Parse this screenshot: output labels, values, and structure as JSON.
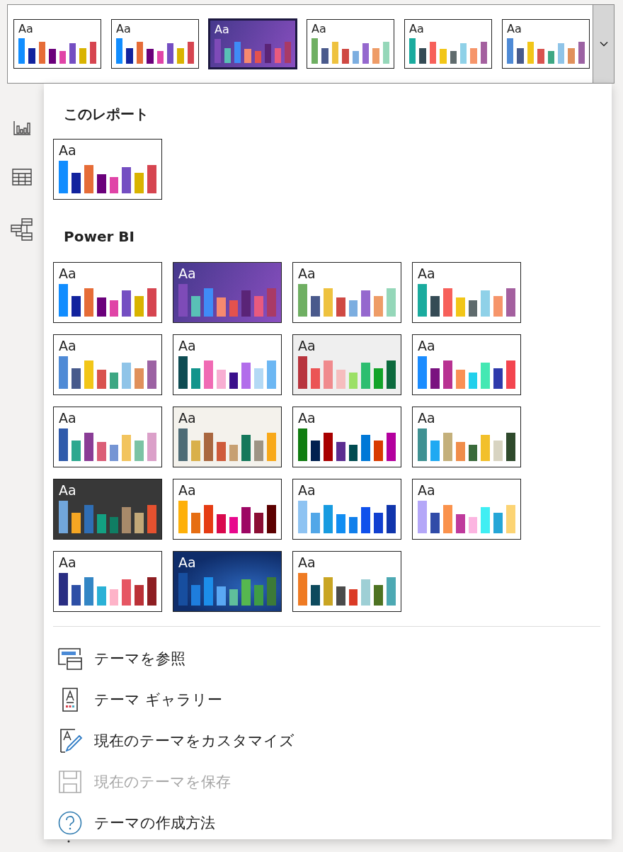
{
  "ribbon": {
    "themes": [
      {
        "label": "Aa",
        "kind": "light",
        "selected": false,
        "bars": [
          {
            "color": "#118dff"
          },
          {
            "color": "#12239e"
          },
          {
            "color": "#e66c37"
          },
          {
            "color": "#6b007b"
          },
          {
            "color": "#e044a7"
          },
          {
            "color": "#744ec2"
          },
          {
            "color": "#d9b300"
          },
          {
            "color": "#d64550"
          }
        ]
      },
      {
        "label": "Aa",
        "kind": "light",
        "selected": false,
        "bars": [
          {
            "color": "#118dff"
          },
          {
            "color": "#12239e"
          },
          {
            "color": "#e66c37"
          },
          {
            "color": "#6b007b"
          },
          {
            "color": "#e044a7"
          },
          {
            "color": "#744ec2"
          },
          {
            "color": "#d9b300"
          },
          {
            "color": "#d64550"
          }
        ]
      },
      {
        "label": "Aa",
        "kind": "purple",
        "selected": true,
        "bars": [
          {
            "color": "#7e4bb8"
          },
          {
            "color": "#59c1b6"
          },
          {
            "color": "#3f8cf7"
          },
          {
            "color": "#f6896f"
          },
          {
            "color": "#e3524e"
          },
          {
            "color": "#5a2477"
          },
          {
            "color": "#e85a7f"
          },
          {
            "color": "#a93a66"
          }
        ]
      },
      {
        "label": "Aa",
        "kind": "light",
        "selected": false,
        "bars": [
          {
            "color": "#6faf62"
          },
          {
            "color": "#4a5a8c"
          },
          {
            "color": "#eec23f"
          },
          {
            "color": "#cf4943"
          },
          {
            "color": "#7caee0"
          },
          {
            "color": "#9568ce"
          },
          {
            "color": "#ee9c67"
          },
          {
            "color": "#95d7b9"
          }
        ]
      },
      {
        "label": "Aa",
        "kind": "light",
        "selected": false,
        "bars": [
          {
            "color": "#1aab9e"
          },
          {
            "color": "#354b55"
          },
          {
            "color": "#f7605a"
          },
          {
            "color": "#f2c618"
          },
          {
            "color": "#5f6b6d"
          },
          {
            "color": "#8fd1e8"
          },
          {
            "color": "#f6956a"
          },
          {
            "color": "#a4609f"
          }
        ]
      },
      {
        "label": "Aa",
        "kind": "light",
        "selected": false,
        "bars": [
          {
            "color": "#4e8ad6"
          },
          {
            "color": "#475a8c"
          },
          {
            "color": "#f2c618"
          },
          {
            "color": "#d9534f"
          },
          {
            "color": "#3da783"
          },
          {
            "color": "#8fc4e8"
          },
          {
            "color": "#e0905b"
          },
          {
            "color": "#9c62a3"
          }
        ]
      }
    ]
  },
  "menu": {
    "sections": [
      {
        "heading": "このレポート",
        "themes": [
          {
            "label": "Aa",
            "kind": "light",
            "selected": false,
            "bars": [
              {
                "color": "#118dff"
              },
              {
                "color": "#12239e"
              },
              {
                "color": "#e66c37"
              },
              {
                "color": "#6b007b"
              },
              {
                "color": "#e044a7"
              },
              {
                "color": "#744ec2"
              },
              {
                "color": "#d9b300"
              },
              {
                "color": "#d64550"
              }
            ]
          }
        ]
      },
      {
        "heading": "Power BI",
        "themes": [
          {
            "label": "Aa",
            "kind": "light",
            "selected": false,
            "bars": [
              {
                "color": "#118dff"
              },
              {
                "color": "#12239e"
              },
              {
                "color": "#e66c37"
              },
              {
                "color": "#6b007b"
              },
              {
                "color": "#e044a7"
              },
              {
                "color": "#744ec2"
              },
              {
                "color": "#d9b300"
              },
              {
                "color": "#d64550"
              }
            ]
          },
          {
            "label": "Aa",
            "kind": "purple",
            "selected": false,
            "bars": [
              {
                "color": "#7e4bb8"
              },
              {
                "color": "#59c1b6"
              },
              {
                "color": "#3f8cf7"
              },
              {
                "color": "#f6896f"
              },
              {
                "color": "#e3524e"
              },
              {
                "color": "#5a2477"
              },
              {
                "color": "#e85a7f"
              },
              {
                "color": "#a93a66"
              }
            ]
          },
          {
            "label": "Aa",
            "kind": "light",
            "selected": false,
            "bars": [
              {
                "color": "#6faf62"
              },
              {
                "color": "#4a5a8c"
              },
              {
                "color": "#eec23f"
              },
              {
                "color": "#cf4943"
              },
              {
                "color": "#7caee0"
              },
              {
                "color": "#9568ce"
              },
              {
                "color": "#ee9c67"
              },
              {
                "color": "#95d7b9"
              }
            ]
          },
          {
            "label": "Aa",
            "kind": "light",
            "selected": false,
            "bars": [
              {
                "color": "#1aab9e"
              },
              {
                "color": "#354b55"
              },
              {
                "color": "#f7605a"
              },
              {
                "color": "#f2c618"
              },
              {
                "color": "#5f6b6d"
              },
              {
                "color": "#8fd1e8"
              },
              {
                "color": "#f6956a"
              },
              {
                "color": "#a4609f"
              }
            ]
          },
          {
            "label": "Aa",
            "kind": "light",
            "selected": false,
            "bars": [
              {
                "color": "#4e8ad6"
              },
              {
                "color": "#475a8c"
              },
              {
                "color": "#f2c618"
              },
              {
                "color": "#d9534f"
              },
              {
                "color": "#3da783"
              },
              {
                "color": "#8fc4e8"
              },
              {
                "color": "#e0905b"
              },
              {
                "color": "#9c62a3"
              }
            ]
          },
          {
            "label": "Aa",
            "kind": "light",
            "selected": false,
            "bars": [
              {
                "color": "#0d4b52"
              },
              {
                "color": "#13948c"
              },
              {
                "color": "#f06ab4"
              },
              {
                "color": "#f8aed3"
              },
              {
                "color": "#3a0f8c"
              },
              {
                "color": "#b26deb"
              },
              {
                "color": "#b3d9f5"
              },
              {
                "color": "#6cb7f3"
              }
            ]
          },
          {
            "label": "Aa",
            "kind": "gray",
            "selected": false,
            "bars": [
              {
                "color": "#b8343d"
              },
              {
                "color": "#eb5455"
              },
              {
                "color": "#f08a8d"
              },
              {
                "color": "#f6bdbe"
              },
              {
                "color": "#9be066"
              },
              {
                "color": "#2dbe70"
              },
              {
                "color": "#12a329"
              },
              {
                "color": "#0c6a3d"
              }
            ]
          },
          {
            "label": "Aa",
            "kind": "light",
            "selected": false,
            "bars": [
              {
                "color": "#1a8cff"
              },
              {
                "color": "#7a1280"
              },
              {
                "color": "#b83291"
              },
              {
                "color": "#fa9055"
              },
              {
                "color": "#22d0ec"
              },
              {
                "color": "#44e8b3"
              },
              {
                "color": "#2e3aab"
              },
              {
                "color": "#f3454f"
              }
            ]
          },
          {
            "label": "Aa",
            "kind": "light",
            "selected": false,
            "bars": [
              {
                "color": "#2f5aab"
              },
              {
                "color": "#2da88f"
              },
              {
                "color": "#8a3d96"
              },
              {
                "color": "#db5e77"
              },
              {
                "color": "#7595d4"
              },
              {
                "color": "#f2c45e"
              },
              {
                "color": "#7bc3a4"
              },
              {
                "color": "#dba0c9"
              }
            ]
          },
          {
            "label": "Aa",
            "kind": "beige",
            "selected": false,
            "bars": [
              {
                "color": "#4d6b75"
              },
              {
                "color": "#d9b04a"
              },
              {
                "color": "#a9673f"
              },
              {
                "color": "#cf5b3b"
              },
              {
                "color": "#c7a072"
              },
              {
                "color": "#15785b"
              },
              {
                "color": "#9e9484"
              },
              {
                "color": "#f8a919"
              }
            ]
          },
          {
            "label": "Aa",
            "kind": "light",
            "selected": false,
            "bars": [
              {
                "color": "#107c10"
              },
              {
                "color": "#002050"
              },
              {
                "color": "#a80000"
              },
              {
                "color": "#5c2d91"
              },
              {
                "color": "#004b50"
              },
              {
                "color": "#0078d7"
              },
              {
                "color": "#d83b01"
              },
              {
                "color": "#b4009e"
              }
            ]
          },
          {
            "label": "Aa",
            "kind": "light",
            "selected": false,
            "bars": [
              {
                "color": "#3f9192"
              },
              {
                "color": "#20a9f2"
              },
              {
                "color": "#c4b07b"
              },
              {
                "color": "#f08d4a"
              },
              {
                "color": "#3a6b3b"
              },
              {
                "color": "#f2c02b"
              },
              {
                "color": "#d8d4c1"
              },
              {
                "color": "#2f4a2c"
              }
            ]
          },
          {
            "label": "Aa",
            "kind": "dark",
            "selected": false,
            "bars": [
              {
                "color": "#71a6db"
              },
              {
                "color": "#f5a623"
              },
              {
                "color": "#2f6eb5"
              },
              {
                "color": "#13a082"
              },
              {
                "color": "#0f7d63"
              },
              {
                "color": "#a88a6a"
              },
              {
                "color": "#c2a878"
              },
              {
                "color": "#e6512f"
              }
            ]
          },
          {
            "label": "Aa",
            "kind": "light",
            "selected": false,
            "bars": [
              {
                "color": "#feb008"
              },
              {
                "color": "#e66e13"
              },
              {
                "color": "#e53c13"
              },
              {
                "color": "#d9094d"
              },
              {
                "color": "#e8088d"
              },
              {
                "color": "#9d0764"
              },
              {
                "color": "#8b0e34"
              },
              {
                "color": "#5c0000"
              }
            ]
          },
          {
            "label": "Aa",
            "kind": "light",
            "selected": false,
            "bars": [
              {
                "color": "#8ec3f2"
              },
              {
                "color": "#52a7e8"
              },
              {
                "color": "#189be0"
              },
              {
                "color": "#118df2"
              },
              {
                "color": "#107feb"
              },
              {
                "color": "#0f50ec"
              },
              {
                "color": "#1140d0"
              },
              {
                "color": "#1035ac"
              }
            ]
          },
          {
            "label": "Aa",
            "kind": "light",
            "selected": false,
            "bars": [
              {
                "color": "#b4a7f8"
              },
              {
                "color": "#304ba8"
              },
              {
                "color": "#fa924c"
              },
              {
                "color": "#bf3a9c"
              },
              {
                "color": "#fcb5e1"
              },
              {
                "color": "#40eef3"
              },
              {
                "color": "#25a6d7"
              },
              {
                "color": "#fcd474"
              }
            ]
          },
          {
            "label": "Aa",
            "kind": "light",
            "selected": false,
            "bars": [
              {
                "color": "#2a2e83"
              },
              {
                "color": "#2d4fa6"
              },
              {
                "color": "#3386c5"
              },
              {
                "color": "#2ab1d6"
              },
              {
                "color": "#feb3c8"
              },
              {
                "color": "#e65663"
              },
              {
                "color": "#bb3137"
              },
              {
                "color": "#8e1e22"
              }
            ]
          },
          {
            "label": "Aa",
            "kind": "image",
            "selected": false,
            "bars": [
              {
                "color": "#174e9f"
              },
              {
                "color": "#1e7ddd"
              },
              {
                "color": "#1c8eea"
              },
              {
                "color": "#5aa8f3"
              },
              {
                "color": "#5fbf9b"
              },
              {
                "color": "#56b74f"
              },
              {
                "color": "#3f9d45"
              },
              {
                "color": "#3c7a38"
              }
            ]
          },
          {
            "label": "Aa",
            "kind": "light",
            "selected": false,
            "bars": [
              {
                "color": "#ef7b23"
              },
              {
                "color": "#0d4a5d"
              },
              {
                "color": "#c9a523"
              },
              {
                "color": "#4b4b4b"
              },
              {
                "color": "#db3b26"
              },
              {
                "color": "#9ecfd5"
              },
              {
                "color": "#4e7322"
              },
              {
                "color": "#4da9b3"
              }
            ]
          }
        ]
      }
    ],
    "actions": [
      {
        "kind": "browse",
        "label": "テーマを参照",
        "disabled": false
      },
      {
        "kind": "gallery",
        "label": "テーマ ギャラリー",
        "disabled": false
      },
      {
        "kind": "customize",
        "label": "現在のテーマをカスタマイズ",
        "disabled": false
      },
      {
        "kind": "save",
        "label": "現在のテーマを保存",
        "disabled": true
      },
      {
        "kind": "help",
        "label": "テーマの作成方法",
        "disabled": false
      }
    ]
  }
}
